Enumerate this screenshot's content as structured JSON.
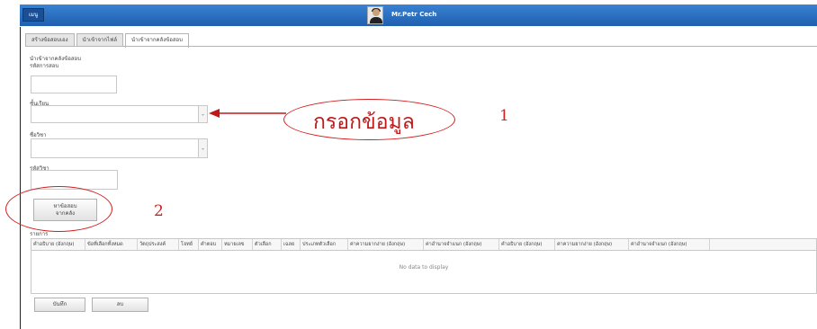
{
  "header": {
    "menu_label": "เมนู",
    "username": "Mr.Petr Cech"
  },
  "tabs": [
    {
      "label": "สร้างข้อสอบเอง",
      "active": false
    },
    {
      "label": "นำเข้าจากไฟล์",
      "active": false
    },
    {
      "label": "นำเข้าจากคลังข้อสอบ",
      "active": true
    }
  ],
  "form": {
    "section_title": "นำเข้าจากคลังข้อสอบ",
    "exam_code_label": "รหัสการสอบ",
    "grade_label": "ชั้นเรียน",
    "subject_label": "ชื่อวิชา",
    "subject_code_label": "รหัสวิชา",
    "search_button": "หาข้อสอบ\nจากคลัง"
  },
  "grid": {
    "section_label": "รายการ",
    "columns": [
      "คำอธิบาย (อังกฤษ)",
      "ข้อที่เลือกทั้งหมด",
      "วัตถุประสงค์",
      "โจทย์",
      "คำตอบ",
      "หมายเลข",
      "ตัวเลือก",
      "เฉลย",
      "ประเภทตัวเลือก",
      "ค่าความยากง่าย (อังกฤษ)",
      "ค่าอำนาจจำแนก (อังกฤษ)",
      "คำอธิบาย (อังกฤษ)",
      "ค่าความยากง่าย (อังกฤษ)",
      "ค่าอำนาจจำแนก (อังกฤษ)"
    ],
    "empty_text": "No data to display"
  },
  "actions": {
    "save_label": "บันทึก",
    "delete_label": "ลบ"
  },
  "annotations": {
    "fill_in_text": "กรอกข้อมูล",
    "step1": "1",
    "step2": "2"
  },
  "colors": {
    "topbar": "#2a6fbf",
    "annotation_red": "#d21f1f"
  }
}
